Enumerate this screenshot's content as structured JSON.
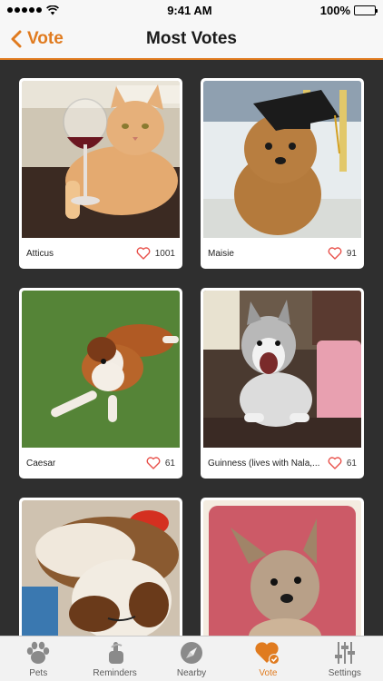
{
  "status_bar": {
    "time": "9:41 AM",
    "battery": "100%"
  },
  "nav": {
    "back_label": "Vote",
    "title": "Most Votes"
  },
  "cards": [
    {
      "name": "Atticus",
      "votes": "1001",
      "photo_icon": "cat-photo"
    },
    {
      "name": "Maisie",
      "votes": "91",
      "photo_icon": "dog-photo"
    },
    {
      "name": "Caesar",
      "votes": "61",
      "photo_icon": "puppy-photo"
    },
    {
      "name": "Guinness (lives with Nala,...",
      "votes": "61",
      "photo_icon": "husky-photo"
    },
    {
      "name": "",
      "votes": "",
      "photo_icon": "sleeping-puppy-photo"
    },
    {
      "name": "",
      "votes": "",
      "photo_icon": "terrier-photo"
    }
  ],
  "tabs": [
    {
      "label": "Pets",
      "icon": "paw-icon"
    },
    {
      "label": "Reminders",
      "icon": "finger-string-icon"
    },
    {
      "label": "Nearby",
      "icon": "compass-icon"
    },
    {
      "label": "Vote",
      "icon": "heart-check-icon"
    },
    {
      "label": "Settings",
      "icon": "sliders-icon"
    }
  ],
  "colors": {
    "accent": "#e07b1f",
    "background": "#2f2f2f",
    "heart": "#e8504a"
  }
}
